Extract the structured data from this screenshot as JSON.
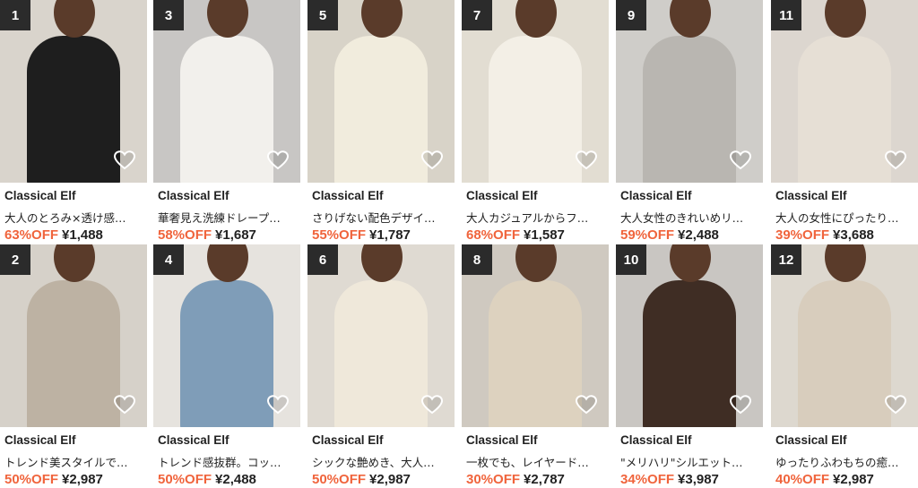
{
  "colors": {
    "discount": "#f0643c",
    "badge_bg": "#2b2b2b"
  },
  "products": [
    {
      "rank": "1",
      "brand": "Classical Elf",
      "title": "大人のとろみ×透け感…",
      "discount": "63%OFF",
      "price": "¥1,488",
      "icon": "heart-icon",
      "bg": "#d9d4cc",
      "garment": "#1e1e1e"
    },
    {
      "rank": "3",
      "brand": "Classical Elf",
      "title": "華奢見え洗練ドレープ…",
      "discount": "58%OFF",
      "price": "¥1,687",
      "icon": "heart-icon",
      "bg": "#c8c6c4",
      "garment": "#f2f0ec"
    },
    {
      "rank": "5",
      "brand": "Classical Elf",
      "title": "さりげない配色デザイ…",
      "discount": "55%OFF",
      "price": "¥1,787",
      "icon": "heart-icon",
      "bg": "#d8d3c8",
      "garment": "#f1ecdd"
    },
    {
      "rank": "7",
      "brand": "Classical Elf",
      "title": "大人カジュアルからフ…",
      "discount": "68%OFF",
      "price": "¥1,587",
      "icon": "heart-icon",
      "bg": "#e2ddd2",
      "garment": "#f3efe6"
    },
    {
      "rank": "9",
      "brand": "Classical Elf",
      "title": "大人女性のきれいめリ…",
      "discount": "59%OFF",
      "price": "¥2,488",
      "icon": "heart-icon",
      "bg": "#cfcdc9",
      "garment": "#b9b6b1"
    },
    {
      "rank": "11",
      "brand": "Classical Elf",
      "title": "大人の女性にぴったり…",
      "discount": "39%OFF",
      "price": "¥3,688",
      "icon": "heart-icon",
      "bg": "#dcd6cf",
      "garment": "#e6dfd5"
    },
    {
      "rank": "2",
      "brand": "Classical Elf",
      "title": "トレンド美スタイルで…",
      "discount": "50%OFF",
      "price": "¥2,987",
      "icon": "heart-icon",
      "bg": "#d6d1c9",
      "garment": "#bdb2a3"
    },
    {
      "rank": "4",
      "brand": "Classical Elf",
      "title": "トレンド感抜群。コッ…",
      "discount": "50%OFF",
      "price": "¥2,488",
      "icon": "heart-icon",
      "bg": "#e6e3de",
      "garment": "#7f9db8"
    },
    {
      "rank": "6",
      "brand": "Classical Elf",
      "title": "シックな艶めき、大人…",
      "discount": "50%OFF",
      "price": "¥2,987",
      "icon": "heart-icon",
      "bg": "#dfdad2",
      "garment": "#efe8da"
    },
    {
      "rank": "8",
      "brand": "Classical Elf",
      "title": "一枚でも、レイヤード…",
      "discount": "30%OFF",
      "price": "¥2,787",
      "icon": "heart-icon",
      "bg": "#cfc9c0",
      "garment": "#ddd2bf"
    },
    {
      "rank": "10",
      "brand": "Classical Elf",
      "title": "\"メリハリ\"シルエット…",
      "discount": "34%OFF",
      "price": "¥3,987",
      "icon": "heart-icon",
      "bg": "#c9c6c2",
      "garment": "#3f2d24"
    },
    {
      "rank": "12",
      "brand": "Classical Elf",
      "title": "ゆったりふわもちの癒…",
      "discount": "40%OFF",
      "price": "¥2,987",
      "icon": "heart-icon",
      "bg": "#ddd8cf",
      "garment": "#d8cdbd"
    }
  ]
}
